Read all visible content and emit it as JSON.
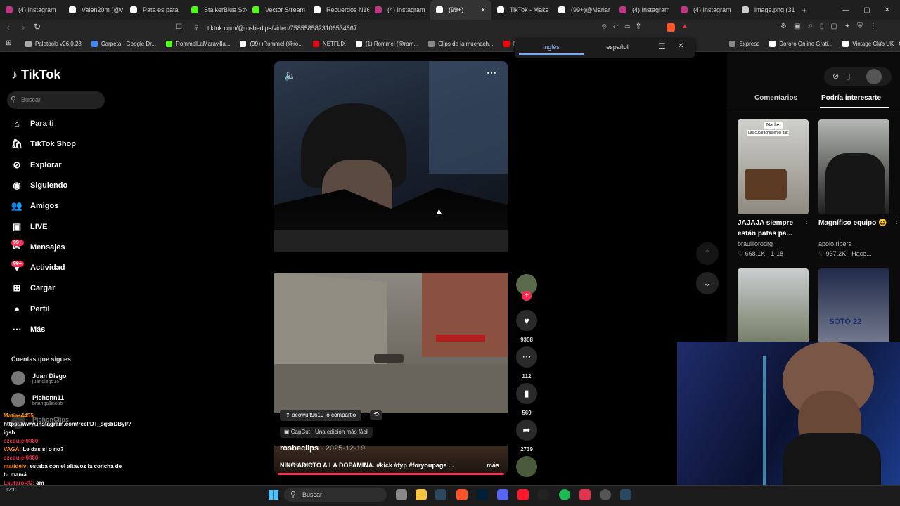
{
  "tabs": [
    {
      "label": "(4) Instagram",
      "color": "#c13584"
    },
    {
      "label": "Valen20m (@v",
      "color": "#ffffff"
    },
    {
      "label": "Pata es pata",
      "color": "#ffffff"
    },
    {
      "label": "StalkerBlue Stre",
      "color": "#53fc18"
    },
    {
      "label": "Vector Stream",
      "color": "#53fc18"
    },
    {
      "label": "Recuerdos N16",
      "color": "#ffffff"
    },
    {
      "label": "(4) Instagram",
      "color": "#c13584"
    },
    {
      "label": "(99+)",
      "color": "#ffffff",
      "active": true
    },
    {
      "label": "TikTok - Make",
      "color": "#ffffff"
    },
    {
      "label": "(99+)@Mariar",
      "color": "#ffffff"
    },
    {
      "label": "(4) Instagram",
      "color": "#c13584"
    },
    {
      "label": "(4) Instagram",
      "color": "#c13584"
    },
    {
      "label": "image.png (31",
      "color": "#cccccc"
    }
  ],
  "address": {
    "url": "tiktok.com/@rosbedips/video/7585585823106534667"
  },
  "bookmarks": [
    {
      "label": "Paletools v26.0.28",
      "color": "#aaaaaa"
    },
    {
      "label": "Carpeta - Google Dr...",
      "color": "#4285f4"
    },
    {
      "label": "RommelLaMaravilla...",
      "color": "#53fc18"
    },
    {
      "label": "(99+)Rommel (@ro...",
      "color": "#ffffff"
    },
    {
      "label": "NETFLIX",
      "color": "#e50914"
    },
    {
      "label": "(1) Rommel (@rom...",
      "color": "#ffffff"
    },
    {
      "label": "Clips de la muchach...",
      "color": "#888888"
    },
    {
      "label": "PORI",
      "color": "#ff0000"
    },
    {
      "label": "Express",
      "color": "#888888"
    },
    {
      "label": "Dororo Online Grati...",
      "color": "#ffffff"
    },
    {
      "label": "Vintage Club UK - O...",
      "color": "#ffffff"
    }
  ],
  "translate": {
    "lang1": "inglés",
    "lang2": "español"
  },
  "sidebar": {
    "logo": "TikTok",
    "search_placeholder": "Buscar",
    "nav": [
      "Para ti",
      "TikTok Shop",
      "Explorar",
      "Siguiendo",
      "Amigos",
      "LIVE",
      "Mensajes",
      "Actividad",
      "Cargar",
      "Perfil",
      "Más"
    ],
    "badge_messages": "99+",
    "badge_activity": "99+",
    "following_title": "Cuentas que sigues",
    "accounts": [
      {
        "name": "Juan Diego",
        "handle": "juandiego15"
      },
      {
        "name": "Pichonn11",
        "handle": "briangallinosb"
      },
      {
        "name": "PichonClips",
        "handle": "pichonclips"
      }
    ]
  },
  "chat": [
    {
      "user": "Matias4455",
      "text": "https://www.instagram.com/reel/DT_sq6bDByl/?igsh"
    },
    {
      "user": "ezequiel9880",
      "text": ""
    },
    {
      "user": "VAGA",
      "text": "Le das si o no?"
    },
    {
      "user": "ezequiel9880",
      "text": ""
    },
    {
      "user": "matidelv",
      "text": "estaba con el altavoz la concha de tu mamá"
    },
    {
      "user": "LautaroRG",
      "text": "em"
    }
  ],
  "video": {
    "shared_by": "beowulf9619 lo compartió",
    "capcut": "CapCut · Una edición más fácil",
    "author": "rosbeclips",
    "date": "2025-12-19",
    "caption": "NIÑO ADICTO A LA DOPAMINA. #kick #fyp #foryoupage ...",
    "more": "más",
    "watermark": "SHOOT EM UP"
  },
  "actions": {
    "likes": "9358",
    "comments": "112",
    "saves": "569",
    "shares": "2739"
  },
  "right_panel": {
    "tab_comments": "Comentarios",
    "tab_suggested": "Podría interesarte",
    "cards": [
      {
        "label": "Nadie:",
        "overlay": "Las cucarachas en el día:",
        "title": "JAJAJA siempre están patas pa...",
        "author": "braulliorodrg",
        "likes": "668.1K",
        "time": "1-18"
      },
      {
        "overlay": "",
        "title": "Magnífico equipo 😆",
        "author": "apolo.ribera",
        "likes": "937.2K",
        "time": "Hace..."
      }
    ],
    "jersey": "SOTO 22"
  },
  "taskbar": {
    "search": "Buscar",
    "weather": "12°C"
  }
}
